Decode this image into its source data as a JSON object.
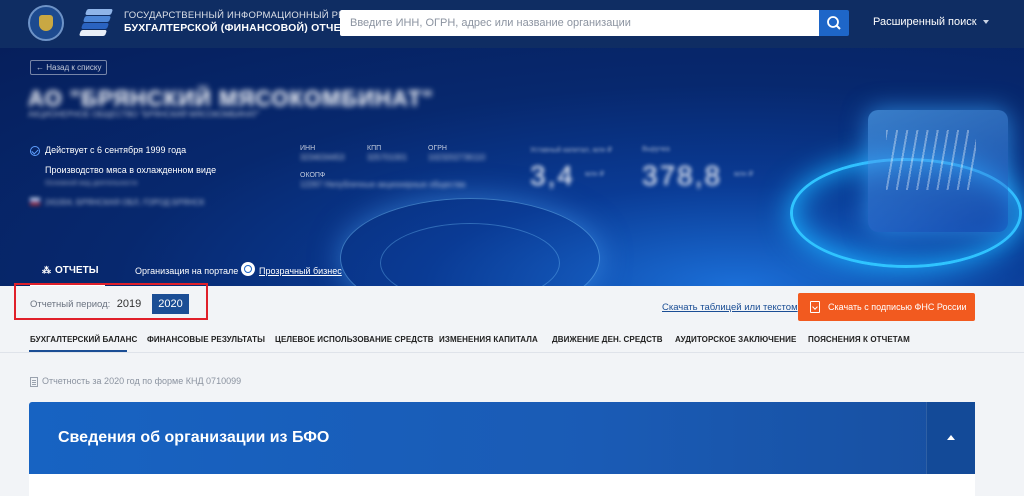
{
  "header": {
    "resource_line1": "ГОСУДАРСТВЕННЫЙ ИНФОРМАЦИОННЫЙ РЕСУРС",
    "resource_line2": "БУХГАЛТЕРСКОЙ (ФИНАНСОВОЙ) ОТЧЕТНОСТИ",
    "search_placeholder": "Введите ИНН, ОГРН, адрес или название организации",
    "advanced_search": "Расширенный поиск",
    "emblem_icon": "fns-emblem-icon",
    "search_icon": "search-icon"
  },
  "hero": {
    "back_link": "← Назад к списку",
    "org_name": "АО \"БРЯНСКИЙ МЯСОКОМБИНАТ\"",
    "org_full_name": "АКЦИОНЕРНОЕ ОБЩЕСТВО \"БРЯНСКИЙ МЯСОКОМБИНАТ\"",
    "status": "Действует с 6 сентября 1999 года",
    "activity": "Производство мяса в охлажденном виде",
    "activity_sub": "Основной вид деятельности",
    "address": "241004, БРЯНСКАЯ ОБЛ, ГОРОД БРЯНСК",
    "requisites": {
      "inn_label": "ИНН",
      "inn_value": "3234034453",
      "kpp_label": "КПП",
      "kpp_value": "325701001",
      "ogrn_label": "ОГРН",
      "ogrn_value": "1023202736110",
      "okopf_label": "ОКОПФ",
      "okopf_value": "12267 Непубличные акционерные общества"
    },
    "metrics": {
      "m1_label": "Уставный капитал, млн ₽",
      "m1_value": "3,4",
      "m1_unit": "млн ₽",
      "m2_label": "Выручка",
      "m2_value": "378,8",
      "m2_unit": "млн ₽"
    },
    "reports_tab": "ОТЧЕТЫ",
    "portal_label": "Организация на портале",
    "portal_link": "Прозрачный бизнес"
  },
  "period": {
    "label": "Отчетный период:",
    "years": [
      "2019",
      "2020"
    ],
    "selected": "2020"
  },
  "actions": {
    "download_text": "Скачать таблицей или текстом",
    "download_fns": "Скачать с подписью ФНС России"
  },
  "tabs": [
    "БУХГАЛТЕРСКИЙ БАЛАНС",
    "ФИНАНСОВЫЕ РЕЗУЛЬТАТЫ",
    "ЦЕЛЕВОЕ ИСПОЛЬЗОВАНИЕ СРЕДСТВ",
    "ИЗМЕНЕНИЯ КАПИТАЛА",
    "ДВИЖЕНИЕ ДЕН. СРЕДСТВ",
    "АУДИТОРСКОЕ ЗАКЛЮЧЕНИЕ",
    "ПОЯСНЕНИЯ К ОТЧЕТАМ"
  ],
  "report": {
    "info": "Отчетность за 2020 год по форме КНД 0710099",
    "section_title": "Сведения об организации из БФО"
  },
  "colors": {
    "header_bg": "#0f2d63",
    "accent": "#1b4e95",
    "orange": "#f25a1f",
    "highlight_frame": "#e0202a",
    "panel": "#1763c2"
  }
}
